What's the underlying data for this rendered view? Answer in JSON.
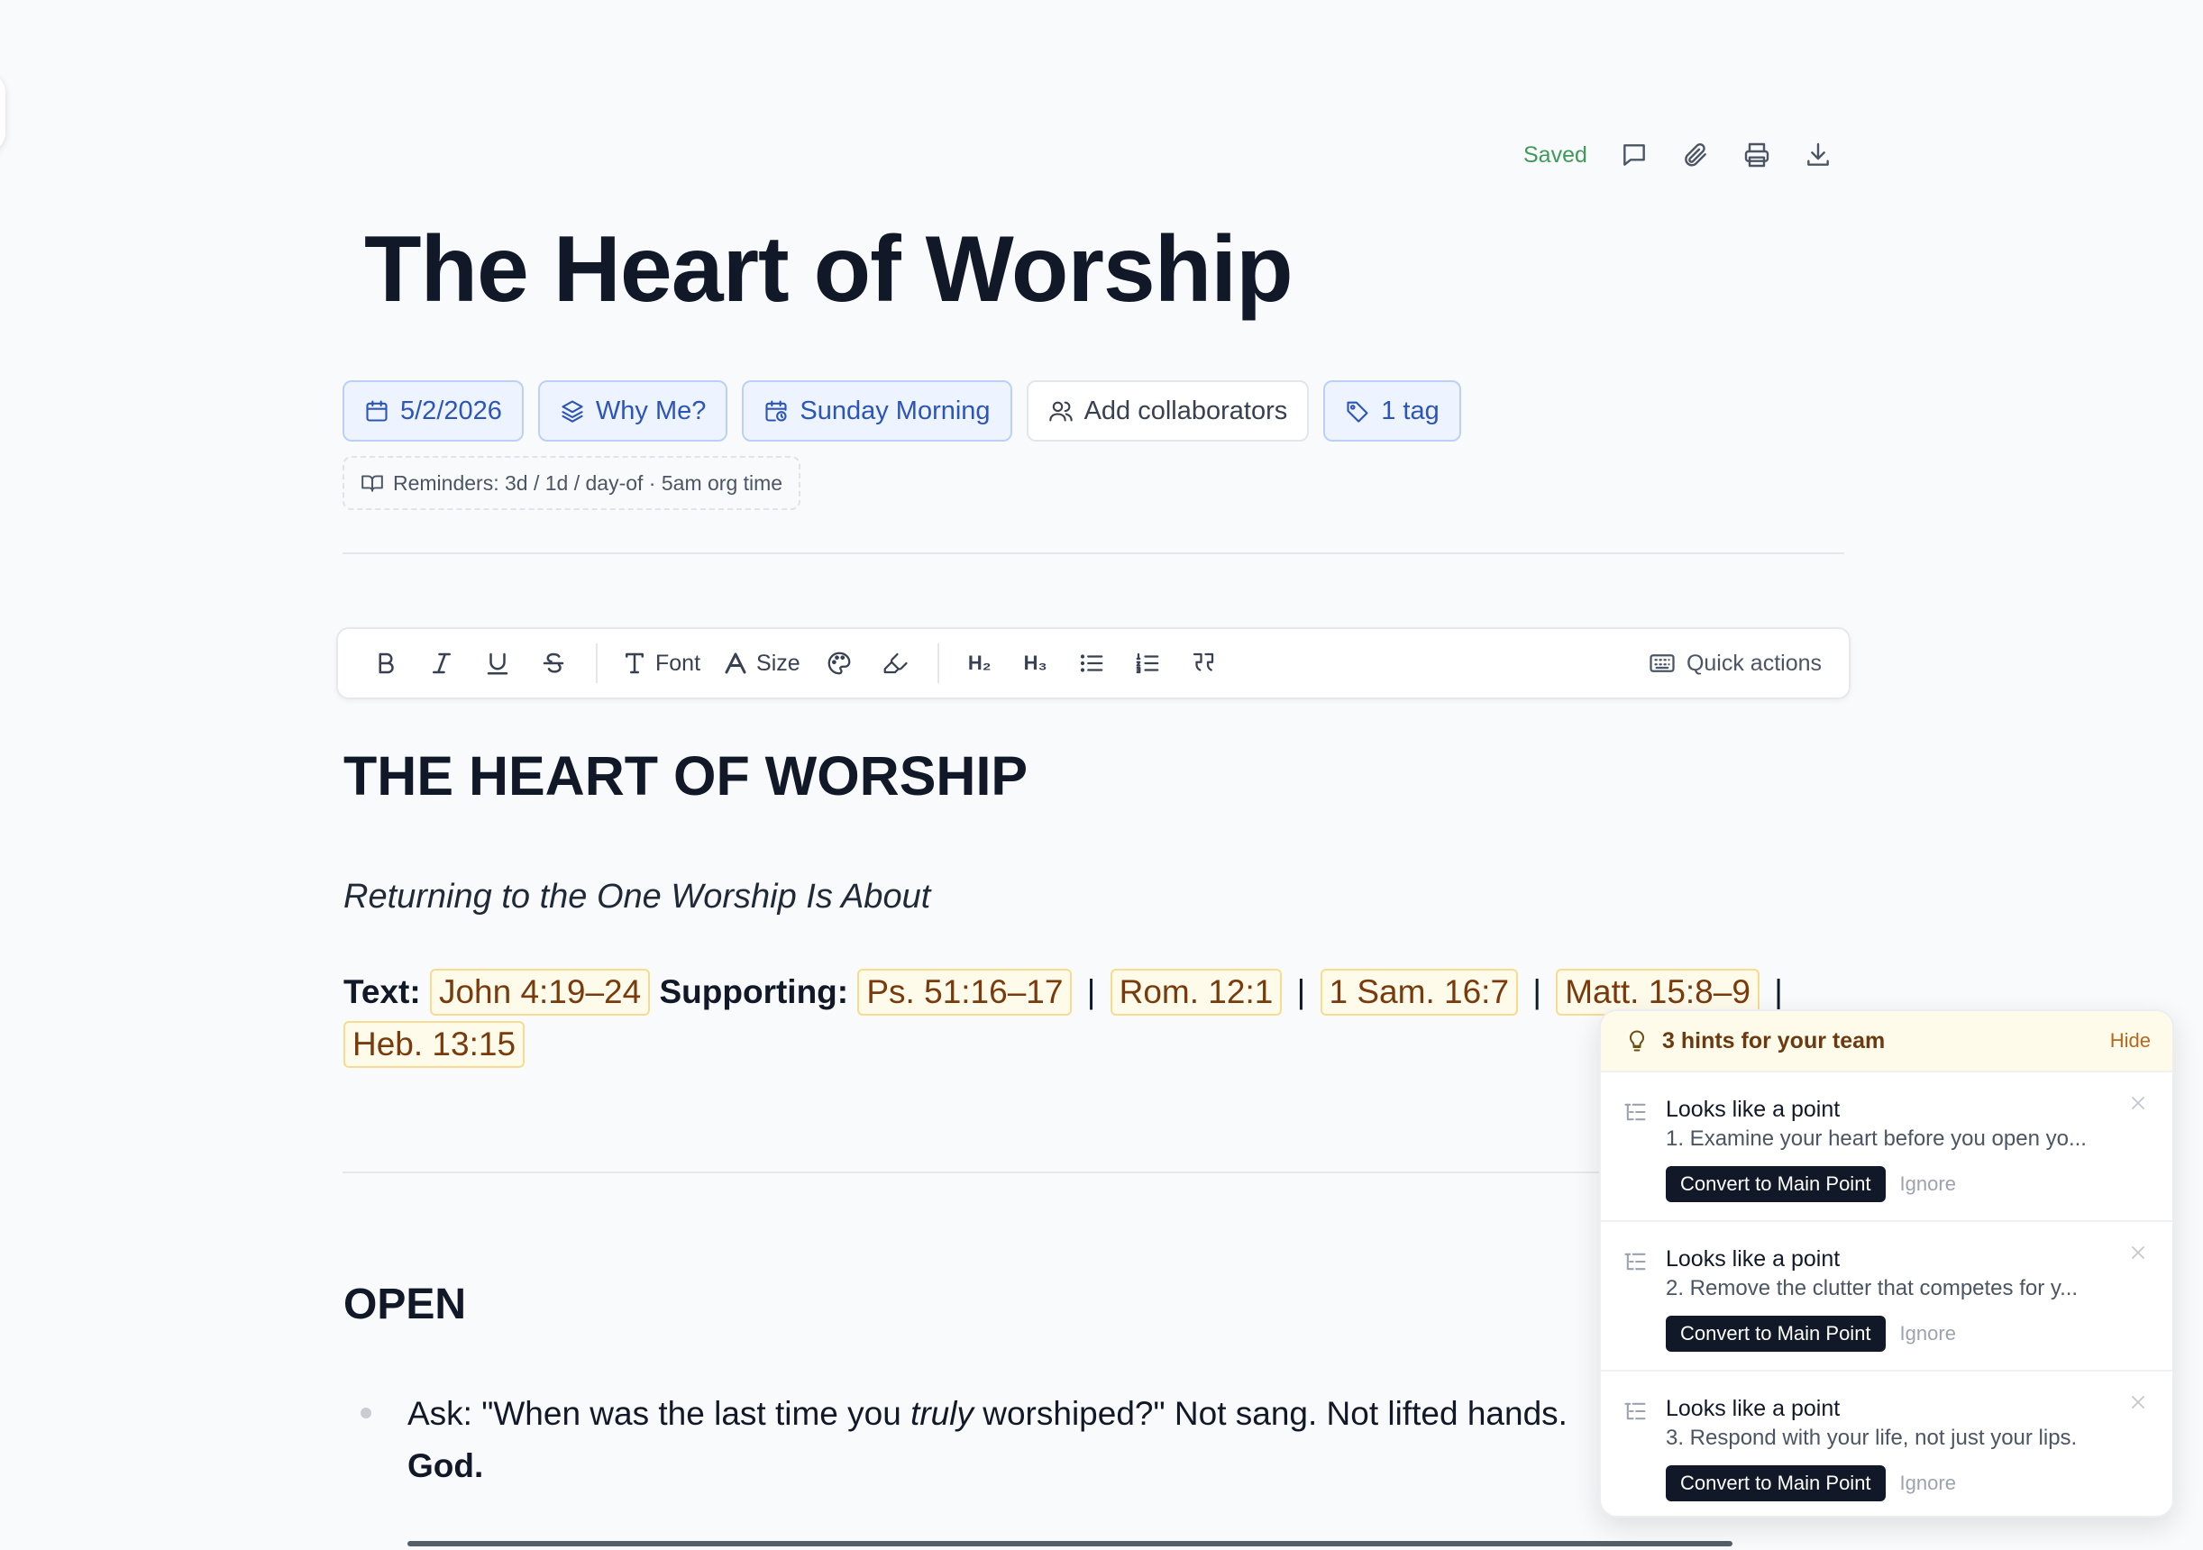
{
  "status": {
    "saved_label": "Saved"
  },
  "topbar_icons": [
    "comment-icon",
    "paperclip-icon",
    "printer-icon",
    "download-icon"
  ],
  "document": {
    "title": "The Heart of Worship",
    "chips": {
      "date": "5/2/2026",
      "series": "Why Me?",
      "service": "Sunday Morning",
      "collaborators": "Add collaborators",
      "tags": "1 tag"
    },
    "reminders": "Reminders: 3d / 1d / day-of · 5am org time"
  },
  "toolbar": {
    "font_label": "Font",
    "size_label": "Size",
    "h2_label": "H₂",
    "h3_label": "H₃",
    "quick_actions_label": "Quick actions"
  },
  "content": {
    "heading": "THE HEART OF WORSHIP",
    "subtitle": "Returning to the One Worship Is About",
    "text_label": "Text:",
    "text_ref": "John 4:19–24",
    "supporting_label": "Supporting:",
    "supporting_refs": [
      "Ps. 51:16–17",
      "Rom. 12:1",
      "1 Sam. 16:7",
      "Matt. 15:8–9",
      "Heb. 13:15"
    ],
    "pipe": "|",
    "open_heading": "OPEN",
    "bullet_1_pre": "Ask: \"When was the last time you ",
    "bullet_1_em": "truly",
    "bullet_1_post": " worshiped?\" Not sang. Not lifted hands.",
    "bullet_1_bold": "God."
  },
  "hints": {
    "title": "3 hints for your team",
    "hide_label": "Hide",
    "convert_label": "Convert to Main Point",
    "ignore_label": "Ignore",
    "items": [
      {
        "title": "Looks like a point",
        "desc": "1. Examine your heart before you open yo..."
      },
      {
        "title": "Looks like a point",
        "desc": "2. Remove the clutter that competes for y..."
      },
      {
        "title": "Looks like a point",
        "desc": "3. Respond with your life, not just your lips."
      }
    ]
  },
  "colors": {
    "accent_blue": "#2c55b8",
    "saved_green": "#3f9a5a",
    "scripture_bg": "#fffbeb",
    "scripture_text": "#7a3b0c",
    "hint_header_bg": "#fffbeb"
  }
}
